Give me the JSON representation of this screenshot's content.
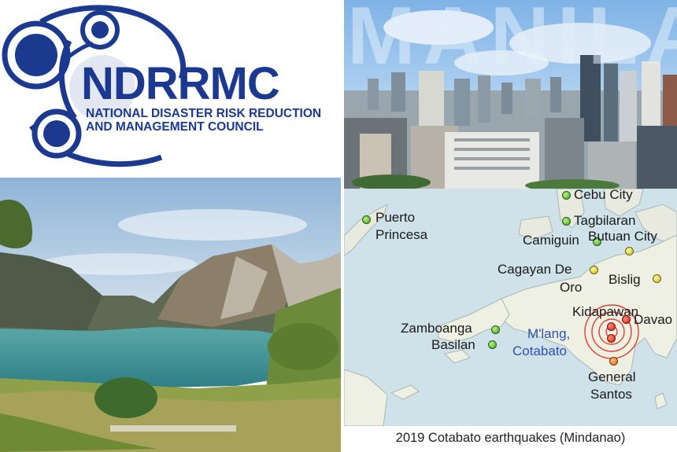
{
  "logo": {
    "title": "NDRRMC",
    "line1": "NATIONAL DISASTER RISK REDUCTION",
    "line2": "AND MANAGEMENT COUNCIL"
  },
  "manila": {
    "word": "MANILA"
  },
  "map": {
    "cities": {
      "cebu": "Cebu City",
      "tagbilaran": "Tagbilaran",
      "puerto": "Puerto",
      "princesa": "Princesa",
      "camiguin": "Camiguin",
      "butuan": "Butuan City",
      "cagayan1": "Cagayan De",
      "cagayan2": "Oro",
      "bislig": "Bislig",
      "kidapawan": "Kidapawan",
      "davao": "Davao",
      "zamboanga": "Zamboanga",
      "basilan": "Basilan",
      "mlang1": "M'lang,",
      "mlang2": "Cotabato",
      "gensan1": "General",
      "gensan2": "Santos"
    },
    "caption": "2019 Cotabato earthquakes (Mindanao)"
  },
  "colors": {
    "logo_blue": "#1b3a8f",
    "epicenter_label": "#2a50b5",
    "epicenter_rings": "#e0281c"
  }
}
